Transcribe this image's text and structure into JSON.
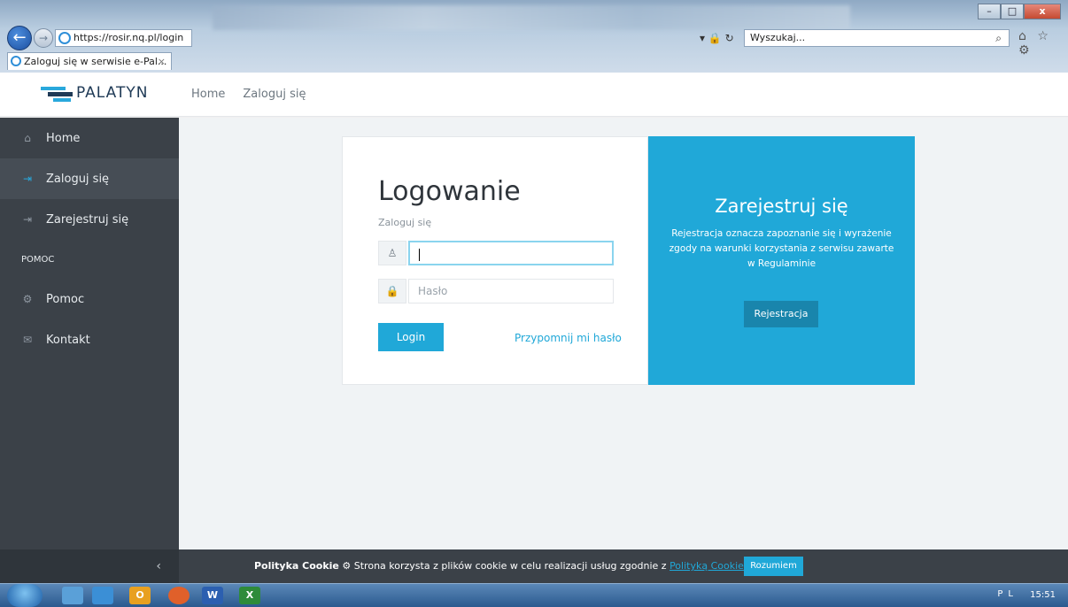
{
  "browser": {
    "address": "https://rosir.nq.pl/login",
    "search_placeholder": "Wyszukaj...",
    "tab_title": "Zaloguj się w serwisie e-Pal...",
    "tab_close": "×",
    "address_controls": "▾ 🔒 ↻",
    "minimize": "–",
    "maximize": "□",
    "close": "x",
    "back": "←",
    "forward": "→",
    "toolbar_icons": "⌂ ☆ ⚙"
  },
  "header": {
    "logo_text": "PALATYN",
    "nav": [
      "Home",
      "Zaloguj się"
    ]
  },
  "sidebar": {
    "items": [
      {
        "label": "Home",
        "icon": "⌂"
      },
      {
        "label": "Zaloguj się",
        "icon": "⇥"
      },
      {
        "label": "Zarejestruj się",
        "icon": "⇥"
      }
    ],
    "heading": "POMOC",
    "help_items": [
      {
        "label": "Pomoc",
        "icon": "⚙"
      },
      {
        "label": "Kontakt",
        "icon": "✉"
      }
    ],
    "collapse_icon": "‹"
  },
  "login": {
    "title": "Logowanie",
    "subtitle": "Zaloguj się",
    "user_icon": "♙",
    "lock_icon": "🔒",
    "password_placeholder": "Hasło",
    "login_button": "Login",
    "forgot_link": "Przypomnij mi hasło"
  },
  "register": {
    "title": "Zarejestruj się",
    "text": "Rejestracja oznacza zapoznanie się i wyrażenie zgody na warunki korzystania z serwisu zawarte w Regulaminie",
    "button": "Rejestracja"
  },
  "cookie": {
    "label": "Polityka Cookie",
    "icon": "⚙",
    "text": "Strona korzysta z plików cookie w celu realizacji usług zgodnie z",
    "link": "Polityką Cookie",
    "button": "Rozumiem"
  },
  "taskbar": {
    "apps": [
      "",
      "",
      "O",
      "",
      "W",
      "X"
    ],
    "tray": "PL",
    "time": "15:51"
  },
  "colors": {
    "accent": "#20a8d8",
    "sidebar": "#3b4148",
    "brand_dark": "#1f3a56"
  }
}
